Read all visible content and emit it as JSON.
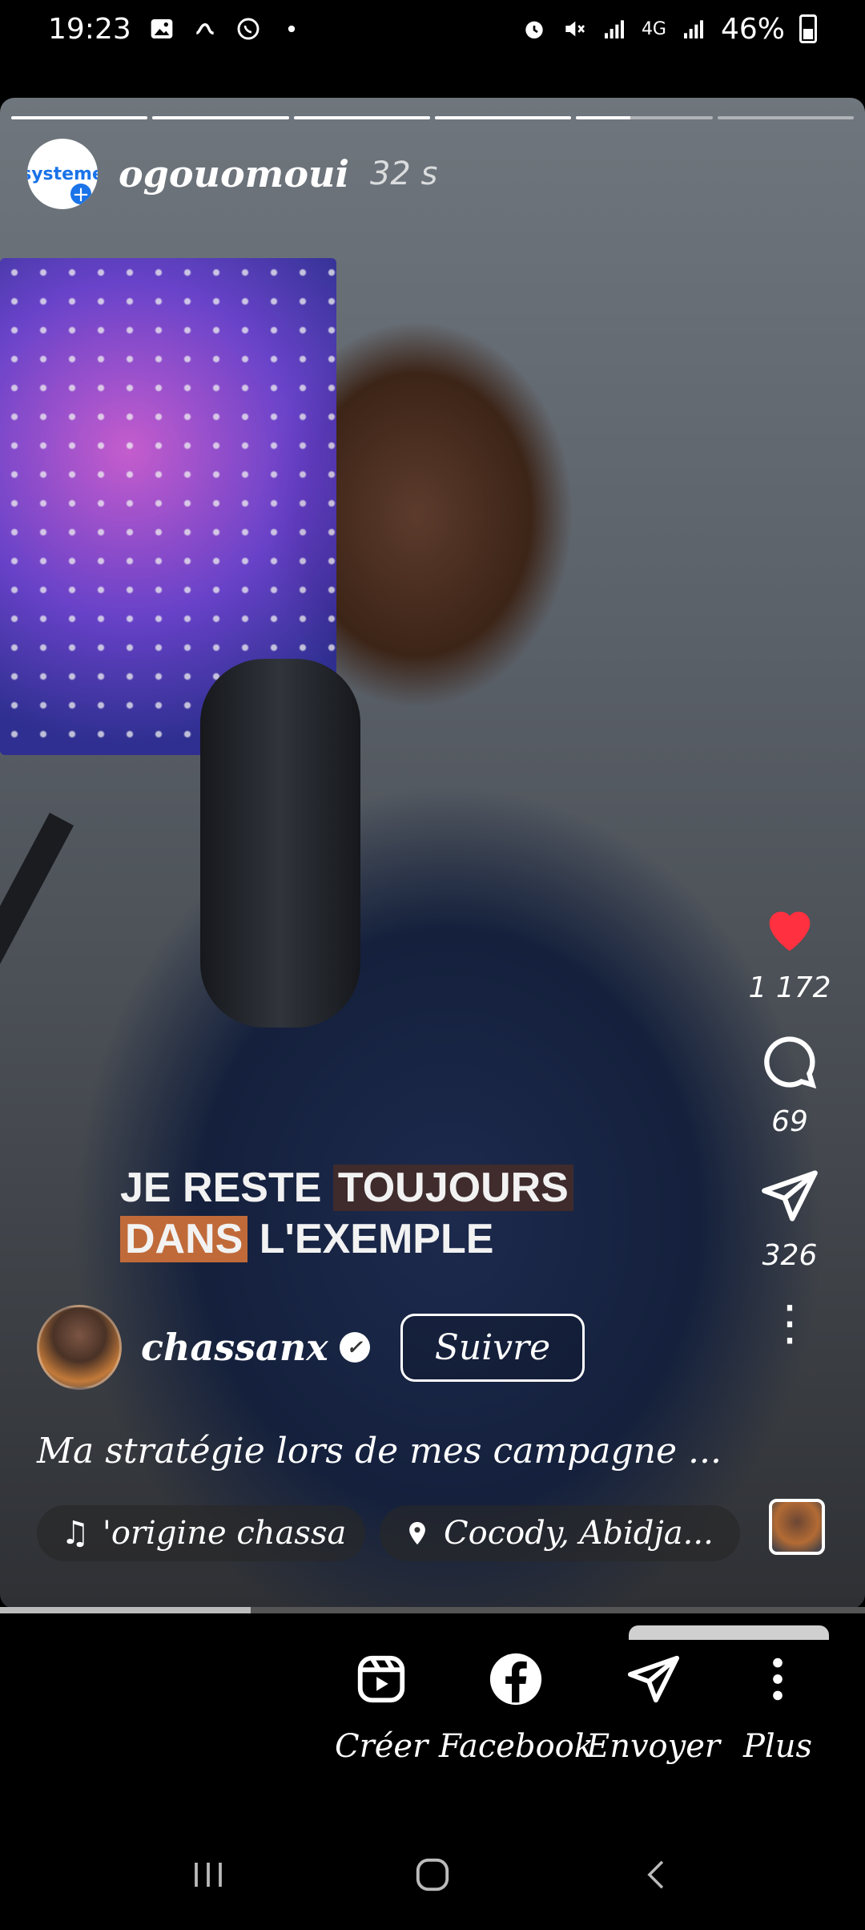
{
  "status_bar": {
    "time": "19:23",
    "network": "4G",
    "battery": "46%"
  },
  "story": {
    "username": "ogouomoui",
    "avatar_text": "systeme",
    "time_ago": "32 s",
    "progress_segments": [
      1,
      1,
      1,
      1,
      0.4,
      0
    ],
    "overlay_caption": {
      "line1_part1": "JE RESTE ",
      "line1_part2": "TOUJOURS",
      "line2_part1": "DANS",
      "line2_part2": " L'EXEMPLE"
    }
  },
  "actions": {
    "likes": "1 172",
    "comments": "69",
    "shares": "326",
    "like_color": "#ff3040"
  },
  "post": {
    "author": "chassanx",
    "follow_label": "Suivre",
    "description": "Ma stratégie lors de mes campagne ...",
    "music": "'origine  chassa",
    "location": "Cocody, Abidja..."
  },
  "video_progress": 0.29,
  "share_bar": {
    "items": [
      {
        "label": "Créer",
        "icon": "reels-icon"
      },
      {
        "label": "Facebook",
        "icon": "facebook-icon"
      },
      {
        "label": "Envoyer",
        "icon": "send-icon"
      },
      {
        "label": "Plus",
        "icon": "more-vertical-icon"
      }
    ]
  }
}
